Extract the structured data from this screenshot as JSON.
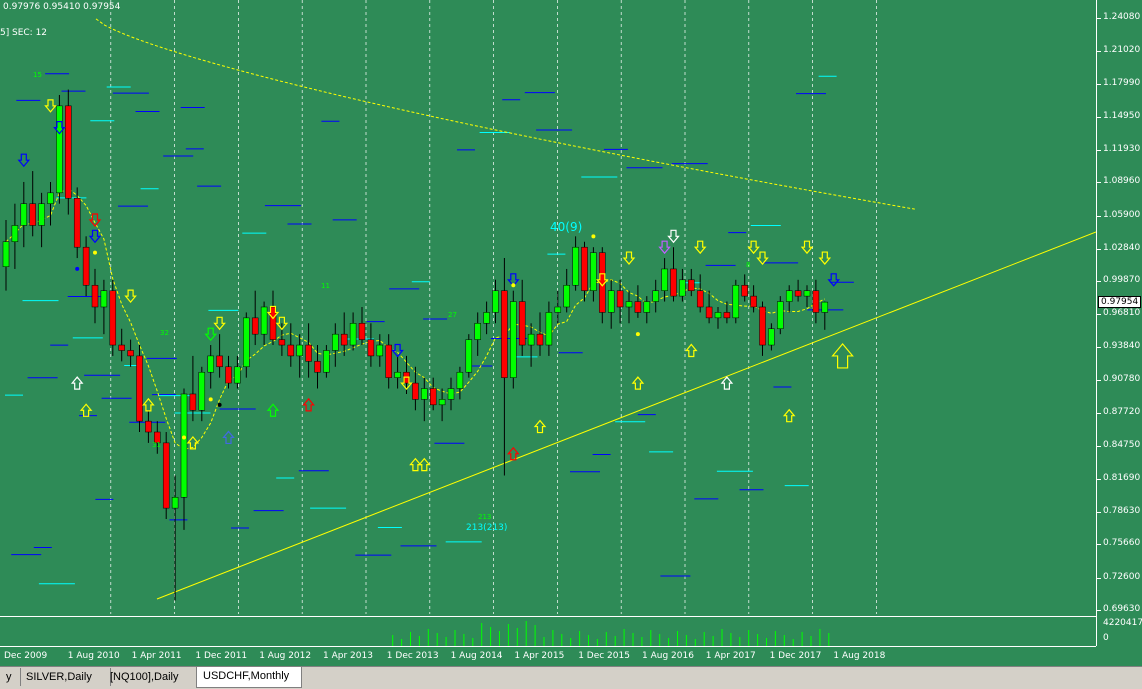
{
  "header": {
    "ohlc": "0.97976 0.95410 0.97954",
    "indicator": "SEC: 12",
    "indicator_prefix": "5]"
  },
  "price_scale": {
    "labels": [
      "1.24080",
      "1.21020",
      "1.17990",
      "1.14950",
      "1.11930",
      "1.08960",
      "1.05900",
      "1.02840",
      "0.99870",
      "0.96810",
      "0.93840",
      "0.90780",
      "0.87720",
      "0.84750",
      "0.81690",
      "0.78630",
      "0.75660",
      "0.72600",
      "0.69630"
    ],
    "current_price": "0.97954"
  },
  "volume_scale": {
    "labels": [
      "4220417",
      "0"
    ]
  },
  "time_axis": {
    "labels": [
      "Dec 2009",
      "1 Aug 2010",
      "1 Apr 2011",
      "1 Dec 2011",
      "1 Aug 2012",
      "1 Apr 2013",
      "1 Dec 2013",
      "1 Aug 2014",
      "1 Apr 2015",
      "1 Dec 2015",
      "1 Aug 2016",
      "1 Apr 2017",
      "1 Dec 2017",
      "1 Aug 2018"
    ]
  },
  "annotations": {
    "count_top": "40(9)",
    "count_bottom": "213(213)",
    "small_labels": [
      "15",
      "32",
      "11",
      "27",
      "8",
      "31",
      "213"
    ]
  },
  "tabs": [
    {
      "label": "y"
    },
    {
      "label": "SILVER,Daily"
    },
    {
      "label": "[NQ100],Daily"
    },
    {
      "label": "USDCHF,Monthly"
    }
  ],
  "colors": {
    "background": "#2e8b57",
    "bull": "#00ff00",
    "bear": "#ff0000",
    "ma": "#ffff00",
    "level_blue": "#0000ff",
    "level_cyan": "#00ffff"
  },
  "chart_data": {
    "type": "candlestick",
    "symbol": "USDCHF",
    "timeframe": "Monthly",
    "ylim": [
      0.6963,
      1.2408
    ],
    "candles": [
      {
        "o": 1.012,
        "h": 1.055,
        "l": 0.99,
        "c": 1.035
      },
      {
        "o": 1.035,
        "h": 1.07,
        "l": 1.01,
        "c": 1.05
      },
      {
        "o": 1.05,
        "h": 1.09,
        "l": 1.03,
        "c": 1.07
      },
      {
        "o": 1.07,
        "h": 1.1,
        "l": 1.04,
        "c": 1.05
      },
      {
        "o": 1.05,
        "h": 1.08,
        "l": 1.03,
        "c": 1.07
      },
      {
        "o": 1.07,
        "h": 1.09,
        "l": 1.05,
        "c": 1.08
      },
      {
        "o": 1.08,
        "h": 1.17,
        "l": 1.07,
        "c": 1.16
      },
      {
        "o": 1.16,
        "h": 1.175,
        "l": 1.06,
        "c": 1.075
      },
      {
        "o": 1.075,
        "h": 1.085,
        "l": 1.02,
        "c": 1.03
      },
      {
        "o": 1.03,
        "h": 1.04,
        "l": 0.985,
        "c": 0.995
      },
      {
        "o": 0.995,
        "h": 1.01,
        "l": 0.96,
        "c": 0.975
      },
      {
        "o": 0.975,
        "h": 1.0,
        "l": 0.95,
        "c": 0.99
      },
      {
        "o": 0.99,
        "h": 1.0,
        "l": 0.93,
        "c": 0.94
      },
      {
        "o": 0.94,
        "h": 0.955,
        "l": 0.925,
        "c": 0.935
      },
      {
        "o": 0.935,
        "h": 0.945,
        "l": 0.92,
        "c": 0.93
      },
      {
        "o": 0.93,
        "h": 0.94,
        "l": 0.86,
        "c": 0.87
      },
      {
        "o": 0.87,
        "h": 0.88,
        "l": 0.85,
        "c": 0.86
      },
      {
        "o": 0.86,
        "h": 0.87,
        "l": 0.84,
        "c": 0.85
      },
      {
        "o": 0.85,
        "h": 0.86,
        "l": 0.78,
        "c": 0.79
      },
      {
        "o": 0.79,
        "h": 0.82,
        "l": 0.705,
        "c": 0.8
      },
      {
        "o": 0.8,
        "h": 0.9,
        "l": 0.77,
        "c": 0.895
      },
      {
        "o": 0.895,
        "h": 0.93,
        "l": 0.87,
        "c": 0.88
      },
      {
        "o": 0.88,
        "h": 0.92,
        "l": 0.87,
        "c": 0.915
      },
      {
        "o": 0.915,
        "h": 0.94,
        "l": 0.9,
        "c": 0.93
      },
      {
        "o": 0.93,
        "h": 0.95,
        "l": 0.91,
        "c": 0.92
      },
      {
        "o": 0.92,
        "h": 0.93,
        "l": 0.9,
        "c": 0.905
      },
      {
        "o": 0.905,
        "h": 0.93,
        "l": 0.9,
        "c": 0.92
      },
      {
        "o": 0.92,
        "h": 0.97,
        "l": 0.91,
        "c": 0.965
      },
      {
        "o": 0.965,
        "h": 0.99,
        "l": 0.94,
        "c": 0.95
      },
      {
        "o": 0.95,
        "h": 0.98,
        "l": 0.94,
        "c": 0.975
      },
      {
        "o": 0.975,
        "h": 0.99,
        "l": 0.94,
        "c": 0.945
      },
      {
        "o": 0.945,
        "h": 0.96,
        "l": 0.93,
        "c": 0.94
      },
      {
        "o": 0.94,
        "h": 0.96,
        "l": 0.92,
        "c": 0.93
      },
      {
        "o": 0.93,
        "h": 0.95,
        "l": 0.91,
        "c": 0.94
      },
      {
        "o": 0.94,
        "h": 0.96,
        "l": 0.91,
        "c": 0.925
      },
      {
        "o": 0.925,
        "h": 0.94,
        "l": 0.9,
        "c": 0.915
      },
      {
        "o": 0.915,
        "h": 0.94,
        "l": 0.91,
        "c": 0.935
      },
      {
        "o": 0.935,
        "h": 0.96,
        "l": 0.92,
        "c": 0.95
      },
      {
        "o": 0.95,
        "h": 0.97,
        "l": 0.93,
        "c": 0.94
      },
      {
        "o": 0.94,
        "h": 0.97,
        "l": 0.935,
        "c": 0.96
      },
      {
        "o": 0.96,
        "h": 0.975,
        "l": 0.94,
        "c": 0.945
      },
      {
        "o": 0.945,
        "h": 0.96,
        "l": 0.92,
        "c": 0.93
      },
      {
        "o": 0.93,
        "h": 0.95,
        "l": 0.92,
        "c": 0.94
      },
      {
        "o": 0.94,
        "h": 0.95,
        "l": 0.9,
        "c": 0.91
      },
      {
        "o": 0.91,
        "h": 0.93,
        "l": 0.9,
        "c": 0.915
      },
      {
        "o": 0.915,
        "h": 0.93,
        "l": 0.895,
        "c": 0.905
      },
      {
        "o": 0.905,
        "h": 0.92,
        "l": 0.88,
        "c": 0.89
      },
      {
        "o": 0.89,
        "h": 0.91,
        "l": 0.87,
        "c": 0.9
      },
      {
        "o": 0.9,
        "h": 0.91,
        "l": 0.88,
        "c": 0.885
      },
      {
        "o": 0.885,
        "h": 0.9,
        "l": 0.87,
        "c": 0.89
      },
      {
        "o": 0.89,
        "h": 0.91,
        "l": 0.88,
        "c": 0.9
      },
      {
        "o": 0.9,
        "h": 0.92,
        "l": 0.89,
        "c": 0.915
      },
      {
        "o": 0.915,
        "h": 0.95,
        "l": 0.91,
        "c": 0.945
      },
      {
        "o": 0.945,
        "h": 0.97,
        "l": 0.93,
        "c": 0.96
      },
      {
        "o": 0.96,
        "h": 0.98,
        "l": 0.95,
        "c": 0.97
      },
      {
        "o": 0.97,
        "h": 1.0,
        "l": 0.96,
        "c": 0.99
      },
      {
        "o": 0.99,
        "h": 1.02,
        "l": 0.82,
        "c": 0.91
      },
      {
        "o": 0.91,
        "h": 0.99,
        "l": 0.9,
        "c": 0.98
      },
      {
        "o": 0.98,
        "h": 1.0,
        "l": 0.93,
        "c": 0.94
      },
      {
        "o": 0.94,
        "h": 0.96,
        "l": 0.92,
        "c": 0.95
      },
      {
        "o": 0.95,
        "h": 0.97,
        "l": 0.93,
        "c": 0.94
      },
      {
        "o": 0.94,
        "h": 0.98,
        "l": 0.93,
        "c": 0.97
      },
      {
        "o": 0.97,
        "h": 0.99,
        "l": 0.96,
        "c": 0.975
      },
      {
        "o": 0.975,
        "h": 1.01,
        "l": 0.97,
        "c": 0.995
      },
      {
        "o": 0.995,
        "h": 1.04,
        "l": 0.99,
        "c": 1.03
      },
      {
        "o": 1.03,
        "h": 1.035,
        "l": 0.98,
        "c": 0.99
      },
      {
        "o": 0.99,
        "h": 1.03,
        "l": 0.98,
        "c": 1.025
      },
      {
        "o": 1.025,
        "h": 1.03,
        "l": 0.96,
        "c": 0.97
      },
      {
        "o": 0.97,
        "h": 1.0,
        "l": 0.955,
        "c": 0.99
      },
      {
        "o": 0.99,
        "h": 1.0,
        "l": 0.96,
        "c": 0.975
      },
      {
        "o": 0.975,
        "h": 0.99,
        "l": 0.96,
        "c": 0.98
      },
      {
        "o": 0.98,
        "h": 0.995,
        "l": 0.965,
        "c": 0.97
      },
      {
        "o": 0.97,
        "h": 0.985,
        "l": 0.96,
        "c": 0.98
      },
      {
        "o": 0.98,
        "h": 1.0,
        "l": 0.97,
        "c": 0.99
      },
      {
        "o": 0.99,
        "h": 1.02,
        "l": 0.98,
        "c": 1.01
      },
      {
        "o": 1.01,
        "h": 1.03,
        "l": 0.98,
        "c": 0.985
      },
      {
        "o": 0.985,
        "h": 1.01,
        "l": 0.98,
        "c": 1.0
      },
      {
        "o": 1.0,
        "h": 1.01,
        "l": 0.985,
        "c": 0.99
      },
      {
        "o": 0.99,
        "h": 1.005,
        "l": 0.97,
        "c": 0.975
      },
      {
        "o": 0.975,
        "h": 0.99,
        "l": 0.96,
        "c": 0.965
      },
      {
        "o": 0.965,
        "h": 0.975,
        "l": 0.955,
        "c": 0.97
      },
      {
        "o": 0.97,
        "h": 0.98,
        "l": 0.96,
        "c": 0.965
      },
      {
        "o": 0.965,
        "h": 1.0,
        "l": 0.96,
        "c": 0.995
      },
      {
        "o": 0.995,
        "h": 1.005,
        "l": 0.98,
        "c": 0.985
      },
      {
        "o": 0.985,
        "h": 0.995,
        "l": 0.97,
        "c": 0.975
      },
      {
        "o": 0.975,
        "h": 0.98,
        "l": 0.93,
        "c": 0.94
      },
      {
        "o": 0.94,
        "h": 0.96,
        "l": 0.935,
        "c": 0.955
      },
      {
        "o": 0.955,
        "h": 0.985,
        "l": 0.95,
        "c": 0.98
      },
      {
        "o": 0.98,
        "h": 0.995,
        "l": 0.97,
        "c": 0.99
      },
      {
        "o": 0.99,
        "h": 1.0,
        "l": 0.98,
        "c": 0.985
      },
      {
        "o": 0.985,
        "h": 0.995,
        "l": 0.975,
        "c": 0.99
      },
      {
        "o": 0.99,
        "h": 1.0,
        "l": 0.96,
        "c": 0.97
      },
      {
        "o": 0.97,
        "h": 0.98,
        "l": 0.954,
        "c": 0.9795
      }
    ]
  }
}
